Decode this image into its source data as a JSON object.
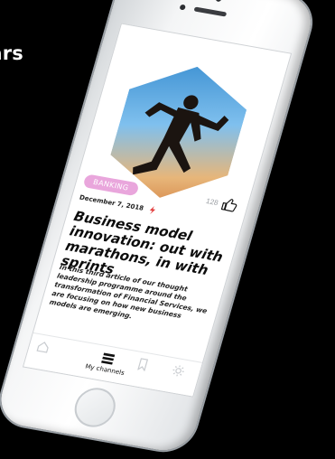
{
  "side_heading": "ars",
  "article": {
    "category_badge": "BANKING",
    "likes_count": "128",
    "date": "December 7, 2018",
    "title": "Business model innovation: out with marathons, in with sprints",
    "excerpt": "In this third article of our thought leadership programme around the transformation of Financial Services, we are focusing on how new business models are emerging."
  },
  "tabbar": {
    "channels_label": "My channels",
    "active_tab": "My channels"
  },
  "icons": {
    "like": "thumbs-up-icon",
    "flash": "lightning-icon",
    "home": "home-icon",
    "channels": "channels-icon",
    "bookmarks": "bookmark-icon",
    "settings": "gear-icon"
  },
  "colors": {
    "badge_bg": "#e9a6dc",
    "lightning": "#e23b3b",
    "background": "#000000"
  }
}
